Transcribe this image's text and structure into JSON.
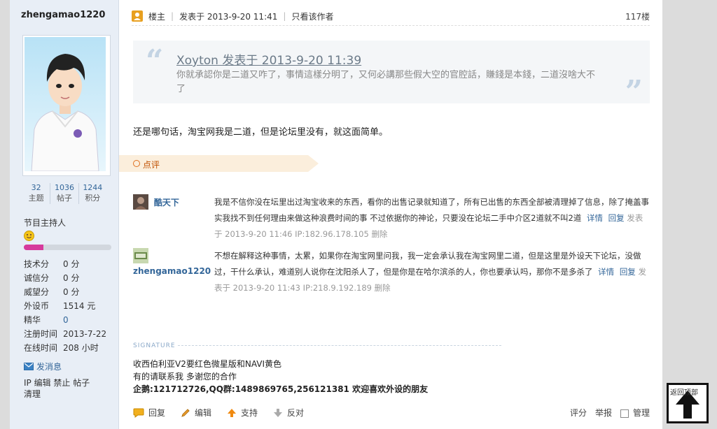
{
  "sidebar": {
    "username": "zhengamao1220",
    "stats": [
      {
        "value": "32",
        "label": "主题"
      },
      {
        "value": "1036",
        "label": "帖子"
      },
      {
        "value": "1244",
        "label": "积分"
      }
    ],
    "role": "节目主持人",
    "level_progress": 0.22,
    "info": [
      {
        "key": "技术分",
        "value": "0 分"
      },
      {
        "key": "诚信分",
        "value": "0 分"
      },
      {
        "key": "威望分",
        "value": "0 分"
      },
      {
        "key": "外设币",
        "value": "1514 元"
      },
      {
        "key": "精华",
        "value": "0"
      },
      {
        "key": "注册时间",
        "value": "2013-7-22"
      },
      {
        "key": "在线时间",
        "value": "208 小时"
      }
    ],
    "send_message": "发消息",
    "admin_links_line1": "IP 编辑 禁止 帖子",
    "admin_links_line2": "清理"
  },
  "post": {
    "owner_label": "楼主",
    "posted_at": "发表于 2013-9-20 11:41",
    "only_author": "只看该作者",
    "floor": "117楼",
    "quote_title": "Xoyton 发表于 2013-9-20 11:39",
    "quote_text": "你就承認你是二道又咋了，事情這樣分明了，又何必講那些假大空的官腔話，賺錢是本錢，二道沒啥大不了",
    "body": "还是哪句话，淘宝网我是二道，但是论坛里没有，就这面简单。"
  },
  "comments_tab": "点评",
  "comments": [
    {
      "author": "酷天下",
      "text": "我是不信你没在坛里出过淘宝收来的东西，看你的出售记录就知道了，所有已出售的东西全部被清理掉了信息，除了掩盖事实我找不到任何理由来做这种浪费时间的事 不过依据你的神论，只要没在论坛二手中介区2道就不叫2道",
      "detail": "详情",
      "reply": "回复",
      "meta": "发表于 2013-9-20 11:46 IP:182.96.178.105",
      "delete": "删除"
    },
    {
      "author": "zhengamao1220",
      "text": "不想在解释这种事情，太累，如果你在淘宝网里问我，我一定会承认我在淘宝网里二道，但是这里是外设天下论坛，没做过，干什么承认，难道别人说你在沈阳杀人了，但是你是在哈尔滨杀的人，你也要承认吗，那你不是多杀了",
      "detail": "详情",
      "reply": "回复",
      "meta": "发表于 2013-9-20 11:43 IP:218.9.192.189",
      "delete": "删除"
    }
  ],
  "signature": {
    "label": "SIGNATURE",
    "line1": "收西伯利亚V2要红色微星版和NAVI黄色",
    "line2": "有的请联系我 多谢您的合作",
    "line3": "企鹅:121712726,QQ群:1489869765,256121381 欢迎喜欢外设的朋友"
  },
  "actions": {
    "reply": "回复",
    "edit": "编辑",
    "support": "支持",
    "oppose": "反对",
    "rate": "评分",
    "report": "举报",
    "manage": "管理"
  },
  "back_to_top": "返回顶部",
  "colors": {
    "link": "#336699",
    "level_bar": "#d63a9c",
    "comment_tab_bg": "#fbeedc"
  }
}
